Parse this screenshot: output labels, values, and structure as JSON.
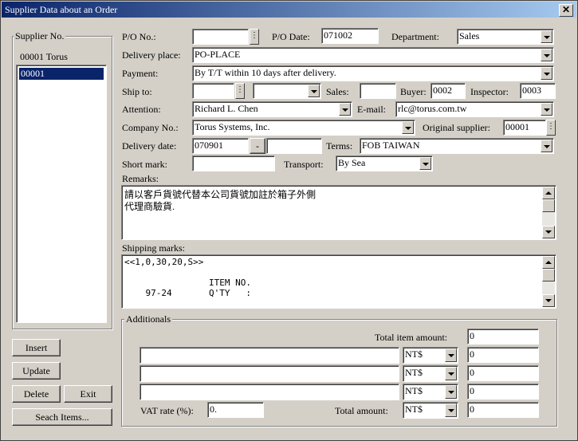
{
  "window": {
    "title": "Supplier Data about an Order",
    "close_glyph": "✕"
  },
  "supplier": {
    "group_label": "Supplier No.",
    "display": "00001 Torus",
    "list_items": [
      "00001"
    ]
  },
  "order": {
    "po_no_label": "P/O No.:",
    "po_no_value": "",
    "po_date_label": "P/O Date:",
    "po_date_value": "071002",
    "department_label": "Department:",
    "department_value": "Sales",
    "delivery_place_label": "Delivery place:",
    "delivery_place_value": "PO-PLACE",
    "payment_label": "Payment:",
    "payment_value": "By T/T within 10 days after delivery.",
    "ship_to_label": "Ship to:",
    "ship_to_value1": "",
    "ship_to_value2": "",
    "sales_label": "Sales:",
    "sales_value": "",
    "buyer_label": "Buyer:",
    "buyer_value": "0002",
    "inspector_label": "Inspector:",
    "inspector_value": "0003",
    "attention_label": "Attention:",
    "attention_value": "Richard L. Chen",
    "email_label": "E-mail:",
    "email_value": "rlc@torus.com.tw",
    "company_no_label": "Company No.:",
    "company_no_value": "Torus Systems, Inc.",
    "original_supplier_label": "Original supplier:",
    "original_supplier_value": "00001",
    "delivery_date_label": "Delivery date:",
    "delivery_date_from": "070901",
    "delivery_date_sep": "-",
    "delivery_date_to": "",
    "terms_label": "Terms:",
    "terms_value": "FOB TAIWAN",
    "short_mark_label": "Short mark:",
    "short_mark_value": "",
    "transport_label": "Transport:",
    "transport_value": "By Sea",
    "remarks_label": "Remarks:",
    "remarks_lines": [
      "請以客戶貨號代替本公司貨號加註於箱子外側",
      "代理商驗貨."
    ],
    "shipping_marks_label": "Shipping marks:",
    "shipping_marks_lines": [
      "<<1,0,30,20,S>>",
      "                ITEM NO.",
      "    97-24       Q'TY   :"
    ]
  },
  "additionals": {
    "group_label": "Additionals",
    "total_item_amount_label": "Total item amount:",
    "total_item_amount_value": "0",
    "rows": [
      {
        "desc": "",
        "currency": "NT$",
        "amount": "0"
      },
      {
        "desc": "",
        "currency": "NT$",
        "amount": "0"
      },
      {
        "desc": "",
        "currency": "NT$",
        "amount": "0"
      }
    ],
    "vat_rate_label": "VAT rate (%):",
    "vat_rate_value": "0.",
    "total_amount_label": "Total amount:",
    "total_amount_currency": "NT$",
    "total_amount_value": "0"
  },
  "buttons": {
    "insert": "Insert",
    "update": "Update",
    "delete": "Delete",
    "exit": "Exit",
    "search_items": "Seach Items..."
  },
  "spin_glyph": "⋮"
}
